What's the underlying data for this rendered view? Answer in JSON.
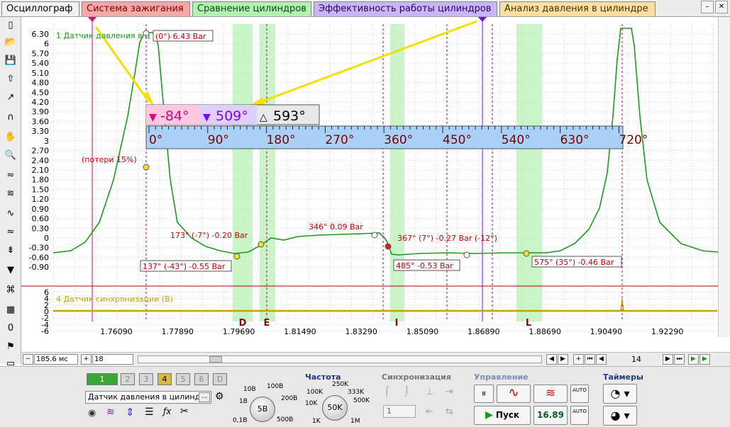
{
  "tabs": [
    {
      "label": "Осциллограф",
      "bg": "#f2f2f2",
      "color": "#000000"
    },
    {
      "label": "Система зажигания",
      "bg": "#f7a7a7",
      "color": "#7a0000"
    },
    {
      "label": "Сравнение цилиндров",
      "bg": "#b6efb6",
      "color": "#005000"
    },
    {
      "label": "Эффективность работы цилиндров",
      "bg": "#c9b6f2",
      "color": "#2a0070"
    },
    {
      "label": "Анализ давления в цилиндре",
      "bg": "#f9e0a2",
      "color": "#4a3200"
    }
  ],
  "window_controls": {
    "minimize": "–",
    "close": "✕"
  },
  "left_toolbar": [
    "file-new-icon",
    "folder-open-icon",
    "save-icon",
    "auto-icon",
    "cursor-icon",
    "curve-icon",
    "hand-icon",
    "zoom-icon",
    "waves-icon",
    "waves2-icon",
    "waves3-icon",
    "waves4-icon",
    "align-icon",
    "filter-icon",
    "network-icon",
    "table-icon",
    "zero-icon",
    "flag-icon",
    "page-icon"
  ],
  "plot": {
    "channel1_label": "1 Датчик давления в ц",
    "channel4_label": "4 Датчик синхронизации (В)",
    "y_ticks_top": [
      "6.30",
      "6",
      "5.70",
      "5.40",
      "5.10",
      "4.80",
      "4.50",
      "4.20",
      "3.90",
      "3.60",
      "3.30",
      "3",
      "2.70",
      "2.40",
      "2.10",
      "1.80",
      "1.50",
      "1.20",
      "0.90",
      "0.60",
      "0.30",
      "0",
      "-0.30",
      "-0.60",
      "-0.90"
    ],
    "y_ticks_bottom": [
      "6",
      "4",
      "2",
      "0",
      "-2",
      "-4",
      "-6"
    ],
    "x_ticks": [
      "1.76090",
      "1.77890",
      "1.79690",
      "1.81490",
      "1.83290",
      "1.85090",
      "1.86890",
      "1.88690",
      "1.90490",
      "1.92290"
    ],
    "zones": [
      "D",
      "E",
      "I",
      "L"
    ],
    "annotations": {
      "peak": "(0°) 6.43 Bar",
      "loss": "(потери 15%)",
      "a173": "173° (-7°) -0.20 Bar",
      "a137": "137° (-43°) -0.55 Bar",
      "a346": "346° 0.09 Bar",
      "a367": "367° (7°) -0.27 Bar (-12°)",
      "a485": "485° -0.53 Bar",
      "a575": "575° (35°) -0.46 Bar"
    },
    "cursor_box": {
      "c1": "-84°",
      "c2": "509°",
      "delta": "593°"
    },
    "degree_scale": [
      "0°",
      "90°",
      "180°",
      "270°",
      "360°",
      "450°",
      "540°",
      "630°",
      "720°"
    ]
  },
  "timebar": {
    "timebase": "185.6 мс",
    "zoom": "18",
    "page": "14"
  },
  "channels": {
    "buttons": [
      "1",
      "2",
      "3",
      "4",
      "5",
      "6",
      "D"
    ],
    "selected_name": "Датчик давления в цилиндре",
    "ellipsis": "..."
  },
  "voltage_knob": {
    "center": "5В",
    "labels": [
      "10В",
      "100В",
      "1В",
      "200В",
      "0,1В",
      "500В"
    ]
  },
  "freq": {
    "title": "Частота",
    "center": "50K",
    "labels": [
      "250K",
      "100K",
      "333K",
      "10K",
      "500K",
      "1K",
      "1M"
    ]
  },
  "sync": {
    "title": "Синхронизация",
    "channel": "1"
  },
  "control": {
    "title": "Управление",
    "run_label": "Пуск",
    "value": "16.89",
    "auto1": "AUTO",
    "auto2": "AUTO"
  },
  "timers": {
    "title": "Таймеры"
  },
  "colors": {
    "trace1": "#1e9a1e",
    "trace4": "#c8a000",
    "highlight_zone": "#c9f5c9",
    "cursor_pink": "#e00080",
    "cursor_purple": "#8000ff",
    "annotation_red": "#d00000"
  }
}
